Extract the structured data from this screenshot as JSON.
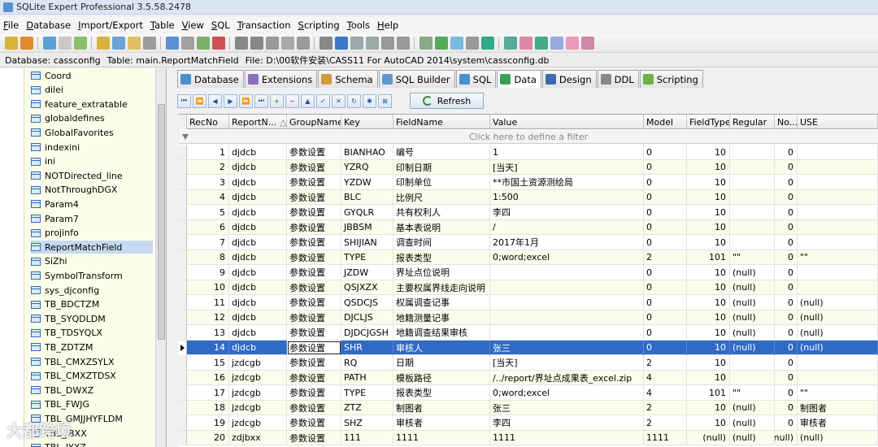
{
  "window": {
    "title": "SQLite Expert Professional 3.5.58.2478"
  },
  "menu": [
    "File",
    "Database",
    "Import/Export",
    "Table",
    "View",
    "SQL",
    "Transaction",
    "Scripting",
    "Tools",
    "Help"
  ],
  "info": {
    "database": "Database: cassconfig",
    "table": "Table: main.ReportMatchField",
    "file": "File: D:\\00软件安装\\CASS11 For AutoCAD 2014\\system\\cassconfig.db"
  },
  "tree": [
    "Coord",
    "dilei",
    "feature_extratable",
    "globaldefines",
    "GlobalFavorites",
    "indexini",
    "ini",
    "NOTDirected_line",
    "NotThroughDGX",
    "Param4",
    "Param7",
    "projinfo",
    "ReportMatchField",
    "SiZhi",
    "SymbolTransform",
    "sys_djconfig",
    "TB_BDCTZM",
    "TB_SYQDLDM",
    "TB_TDSYQLX",
    "TB_ZDTZM",
    "TBL_CMXZSYLX",
    "TBL_CMXZTDSX",
    "TBL_DWXZ",
    "TBL_FWJG",
    "TBL_GMJJHYFLDM",
    "TBL_JBXX",
    "TBL_JYXZ"
  ],
  "tabs": [
    "Database",
    "Extensions",
    "Schema",
    "SQL Builder",
    "SQL",
    "Data",
    "Design",
    "DDL",
    "Scripting"
  ],
  "refresh_label": "Refresh",
  "columns": [
    "RecNo",
    "ReportN...",
    "GroupName",
    "Key",
    "FieldName",
    "Value",
    "Model",
    "FieldType",
    "Regular",
    "No...",
    "USE"
  ],
  "filter_text": "Click here to define a filter",
  "rows": [
    [
      "1",
      "djdcb",
      "参数设置",
      "BIANHAO",
      "编号",
      "1",
      "0",
      "10",
      "",
      "0",
      ""
    ],
    [
      "2",
      "djdcb",
      "参数设置",
      "YZRQ",
      "印制日期",
      "[当天]",
      "0",
      "10",
      "",
      "0",
      ""
    ],
    [
      "3",
      "djdcb",
      "参数设置",
      "YZDW",
      "印制单位",
      "**市国土资源测绘局",
      "0",
      "10",
      "",
      "0",
      ""
    ],
    [
      "4",
      "djdcb",
      "参数设置",
      "BLC",
      "比例尺",
      "1:500",
      "0",
      "10",
      "",
      "0",
      ""
    ],
    [
      "5",
      "djdcb",
      "参数设置",
      "GYQLR",
      "共有权利人",
      "李四",
      "0",
      "10",
      "",
      "0",
      ""
    ],
    [
      "6",
      "djdcb",
      "参数设置",
      "JBBSM",
      "基本表说明",
      "/",
      "0",
      "10",
      "",
      "0",
      ""
    ],
    [
      "7",
      "djdcb",
      "参数设置",
      "SHIJIAN",
      "调查时间",
      "2017年1月",
      "0",
      "10",
      "",
      "0",
      ""
    ],
    [
      "8",
      "djdcb",
      "参数设置",
      "TYPE",
      "报表类型",
      "0;word;excel",
      "2",
      "101",
      "\"\"",
      "0",
      "\"\""
    ],
    [
      "9",
      "djdcb",
      "参数设置",
      "JZDW",
      "界址点位说明",
      "",
      "0",
      "10",
      "(null)",
      "0",
      ""
    ],
    [
      "10",
      "djdcb",
      "参数设置",
      "QSJXZX",
      "主要权属界线走向说明",
      "",
      "0",
      "10",
      "(null)",
      "0",
      ""
    ],
    [
      "11",
      "djdcb",
      "参数设置",
      "QSDCJS",
      "权属调查记事",
      "",
      "0",
      "10",
      "(null)",
      "0",
      "(null)"
    ],
    [
      "12",
      "djdcb",
      "参数设置",
      "DJCLJS",
      "地籍测量记事",
      "",
      "0",
      "10",
      "(null)",
      "0",
      "(null)"
    ],
    [
      "13",
      "djdcb",
      "参数设置",
      "DJDCJGSH",
      "地籍调查结果审核",
      "",
      "0",
      "10",
      "(null)",
      "0",
      "(null)"
    ],
    [
      "14",
      "djdcb",
      "参数设置",
      "SHR",
      "审核人",
      "张三",
      "0",
      "10",
      "(null)",
      "0",
      "(null)"
    ],
    [
      "15",
      "jzdcgb",
      "参数设置",
      "RQ",
      "日期",
      "[当天]",
      "2",
      "10",
      "",
      "0",
      ""
    ],
    [
      "16",
      "jzdcgb",
      "参数设置",
      "PATH",
      "模板路径",
      "/../report/界址点成果表_excel.zip",
      "4",
      "10",
      "",
      "0",
      ""
    ],
    [
      "17",
      "jzdcgb",
      "参数设置",
      "TYPE",
      "报表类型",
      "0;word;excel",
      "4",
      "101",
      "\"\"",
      "0",
      "\"\""
    ],
    [
      "18",
      "jzdcgb",
      "参数设置",
      "ZTZ",
      "制图者",
      "张三",
      "2",
      "10",
      "(null)",
      "0",
      "制图者"
    ],
    [
      "19",
      "jzdcgb",
      "参数设置",
      "SHZ",
      "审核者",
      "李四",
      "2",
      "10",
      "(null)",
      "0",
      "审核者"
    ],
    [
      "20",
      "zdjbxx",
      "参数设置",
      "111",
      "1111",
      "1111",
      "1111",
      "(null)",
      "(null)",
      "(null)",
      "(null)"
    ]
  ],
  "selected_row": 14,
  "watermark": "大都跨境"
}
